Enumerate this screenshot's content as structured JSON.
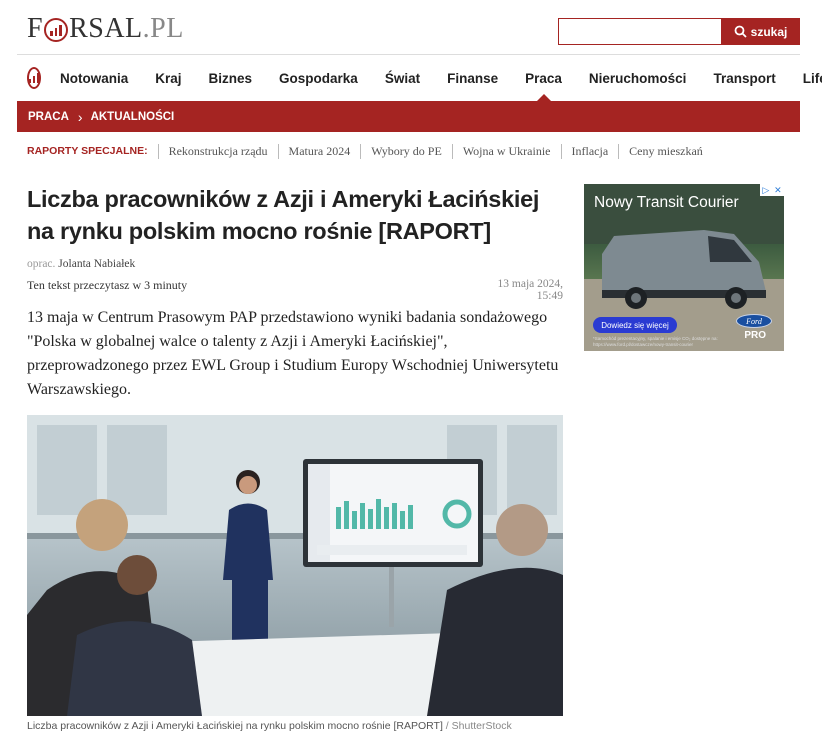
{
  "site": {
    "logo_pre": "F",
    "logo_post": "RSAL",
    "logo_tld": ".PL"
  },
  "search": {
    "placeholder": "",
    "button_label": "szukaj"
  },
  "nav": {
    "items": [
      "Notowania",
      "Kraj",
      "Biznes",
      "Gospodarka",
      "Świat",
      "Finanse",
      "Praca",
      "Nieruchomości",
      "Transport",
      "Lifestyle"
    ],
    "active": "Praca"
  },
  "breadcrumb": {
    "section": "PRACA",
    "sub": "AKTUALNOŚCI"
  },
  "specials": {
    "label": "RAPORTY SPECJALNE:",
    "items": [
      "Rekonstrukcja rządu",
      "Matura 2024",
      "Wybory do PE",
      "Wojna w Ukrainie",
      "Inflacja",
      "Ceny mieszkań"
    ]
  },
  "article": {
    "title": "Liczba pracowników z Azji i Ameryki Łacińskiej na rynku polskim mocno rośnie [RAPORT]",
    "author_prefix": "oprac.",
    "author": "Jolanta Nabiałek",
    "read_time": "Ten tekst przeczytasz w 3 minuty",
    "date": "13 maja 2024, 15:49",
    "lead": "13 maja w Centrum Prasowym PAP przedstawiono wyniki badania sondażowego \"Polska w globalnej walce o talenty z Azji i Ameryki Łacińskiej\", przeprowadzonego przez EWL Group i Studium Europy Wschodniej Uniwersytetu Warszawskiego.",
    "caption": "Liczba pracowników z Azji i Ameryki Łacińskiej na rynku polskim mocno rośnie [RAPORT]",
    "caption_source": " / ShutterStock"
  },
  "ad": {
    "headline": "Nowy Transit Courier",
    "cta": "Dowiedz się więcej",
    "brand": "Ford",
    "sub_brand": "PRO",
    "fine_print": "*Samochód prezentacyjny, spalanie i emisje CO₂ dostępne na: https://www.ford.pl/dostawcze/nowy-transit-courier"
  },
  "colors": {
    "brand": "#a52422",
    "text": "#222222",
    "muted": "#888888"
  }
}
